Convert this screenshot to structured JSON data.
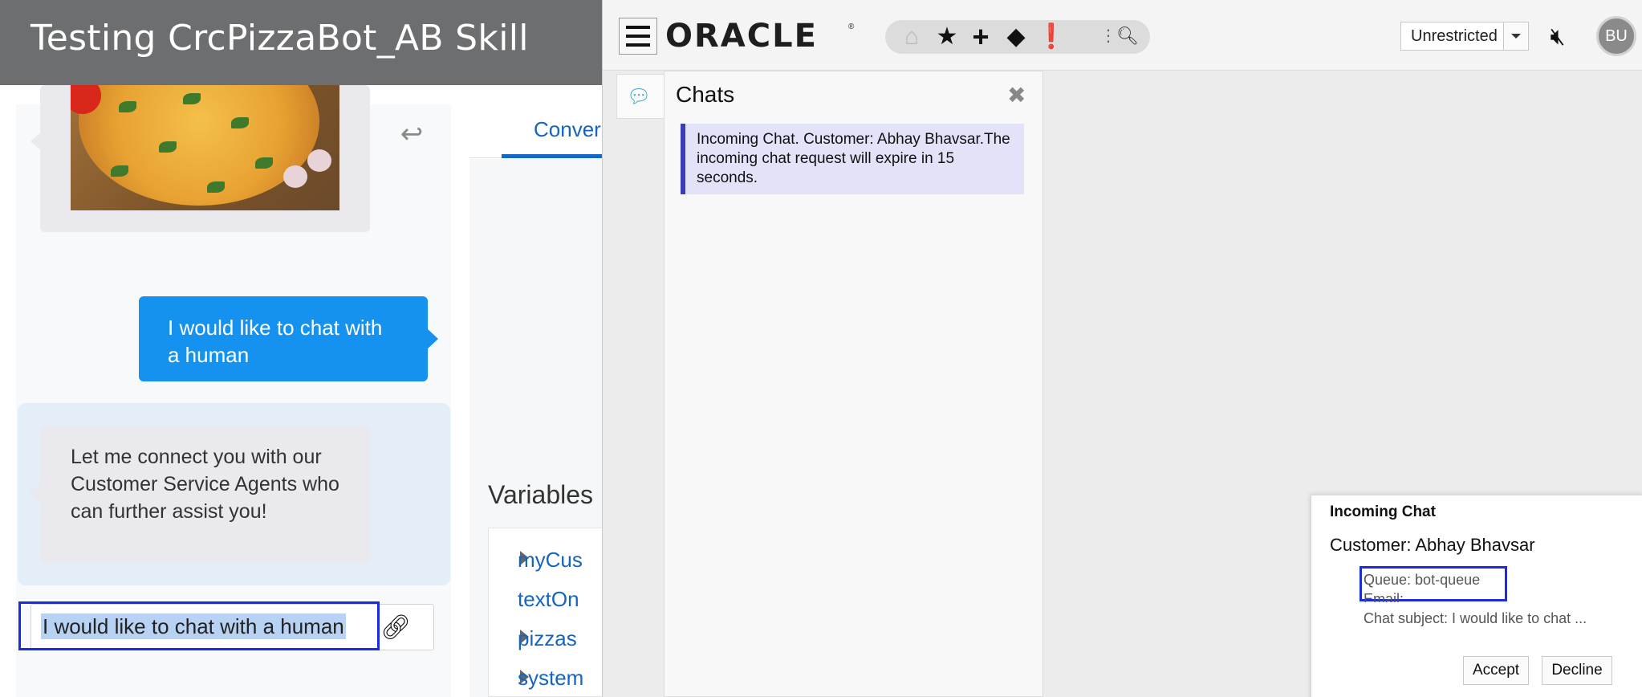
{
  "tester": {
    "title": "Testing CrcPizzaBot_AB Skill",
    "user_message": "I would like to chat with a human",
    "bot_reply": "Let me connect you with our Customer Service Agents who can further assist you!",
    "input_value": "I would like to chat with a human",
    "conversation_tab": "Conver",
    "variables_title": "Variables",
    "variables": [
      {
        "name": "myCus",
        "expandable": true
      },
      {
        "name": "textOn",
        "expandable": false
      },
      {
        "name": "pizzas",
        "expandable": true
      },
      {
        "name": "system",
        "expandable": true
      }
    ],
    "icons": {
      "undo": "undo-icon",
      "attach": "link-icon"
    }
  },
  "service": {
    "logo": "ORACLE",
    "logo_mark": "®",
    "queue_select": "Unrestricted",
    "avatar_initials": "BU",
    "icons": [
      "home-icon",
      "star-icon",
      "plus-icon",
      "bell-icon",
      "notification-icon",
      "mute-icon"
    ],
    "chats_panel": {
      "title": "Chats",
      "alert": "Incoming Chat. Customer: Abhay Bhavsar.The incoming chat request will expire in 15 seconds."
    },
    "toast": {
      "title": "Incoming Chat",
      "customer": "Customer: Abhay Bhavsar",
      "queue": "Queue: bot-queue",
      "email": "Email:",
      "subject": "Chat subject: I would like to chat ...",
      "accept_label": "Accept",
      "decline_label": "Decline"
    }
  },
  "colors": {
    "user_bubble": "#1592f0",
    "highlight_box": "#1b2be0",
    "alert_border": "#3b3fb3",
    "header_gray": "#6d6e70"
  }
}
